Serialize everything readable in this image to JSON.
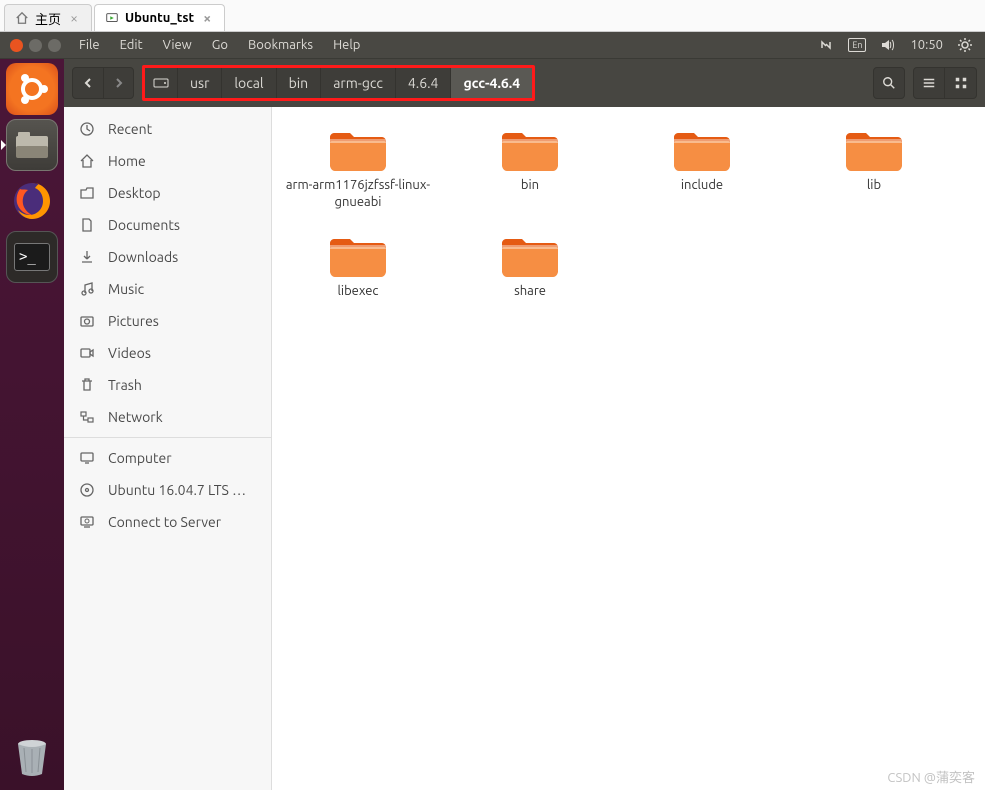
{
  "host_tabs": [
    {
      "label": "主页",
      "active": false,
      "icon": "home"
    },
    {
      "label": "Ubuntu_tst",
      "active": true,
      "icon": "vm"
    }
  ],
  "menubar": {
    "items": [
      "File",
      "Edit",
      "View",
      "Go",
      "Bookmarks",
      "Help"
    ]
  },
  "indicators": {
    "lang": "En",
    "clock": "10:50"
  },
  "breadcrumb": [
    "usr",
    "local",
    "bin",
    "arm-gcc",
    "4.6.4",
    "gcc-4.6.4"
  ],
  "sidebar": {
    "places": [
      {
        "icon": "recent",
        "label": "Recent"
      },
      {
        "icon": "home",
        "label": "Home"
      },
      {
        "icon": "desktop",
        "label": "Desktop"
      },
      {
        "icon": "documents",
        "label": "Documents"
      },
      {
        "icon": "downloads",
        "label": "Downloads"
      },
      {
        "icon": "music",
        "label": "Music"
      },
      {
        "icon": "pictures",
        "label": "Pictures"
      },
      {
        "icon": "videos",
        "label": "Videos"
      },
      {
        "icon": "trash",
        "label": "Trash"
      }
    ],
    "network_label": "Network",
    "devices": [
      {
        "icon": "computer",
        "label": "Computer"
      },
      {
        "icon": "disc",
        "label": "Ubuntu 16.04.7 LTS …"
      },
      {
        "icon": "connect",
        "label": "Connect to Server"
      }
    ]
  },
  "folders": [
    "arm-arm1176jzfssf-linux-gnueabi",
    "bin",
    "include",
    "lib",
    "libexec",
    "share"
  ],
  "watermark": "CSDN @蒲奕客"
}
